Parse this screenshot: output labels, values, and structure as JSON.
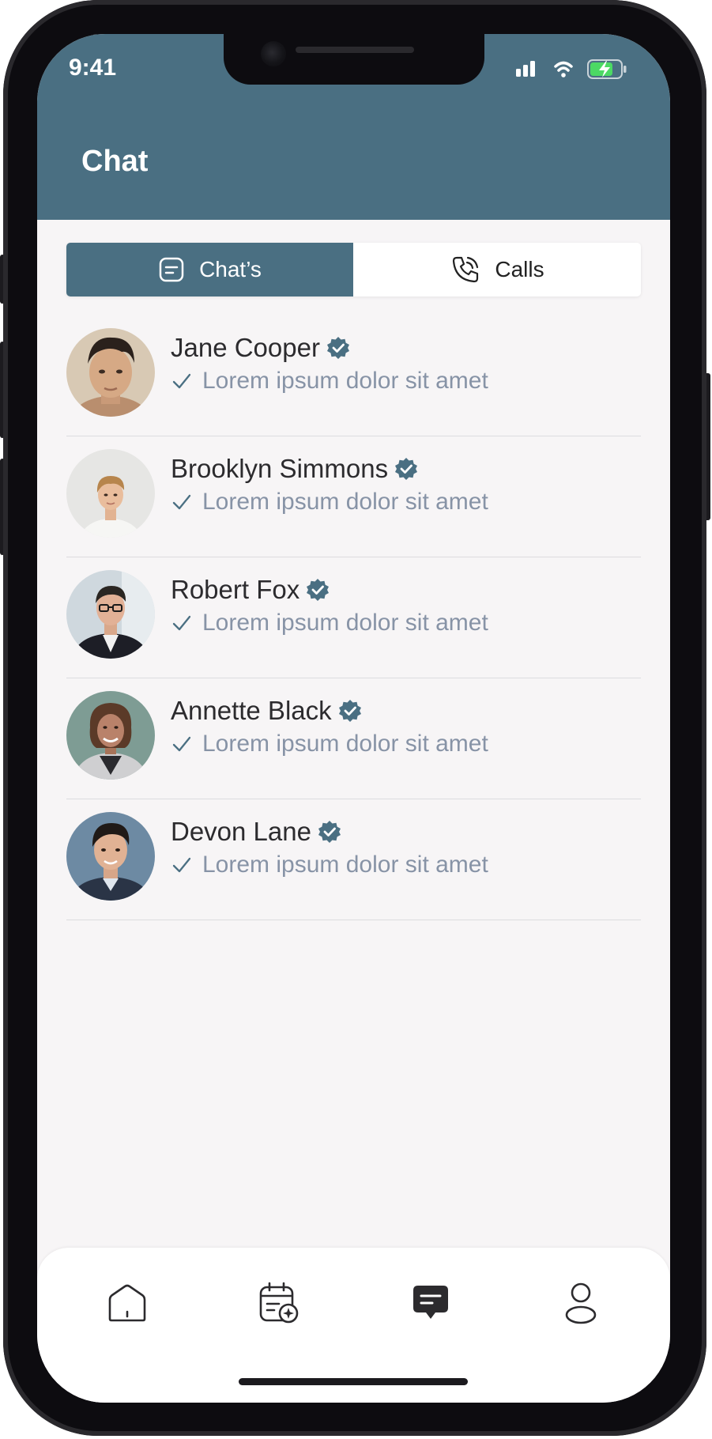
{
  "status_bar": {
    "time": "9:41"
  },
  "header": {
    "title": "Chat"
  },
  "tabs": [
    {
      "label": "Chat’s",
      "icon": "chat-note-icon",
      "active": true
    },
    {
      "label": "Calls",
      "icon": "phone-icon",
      "active": false
    }
  ],
  "contacts": [
    {
      "name": "Jane Cooper",
      "message": "Lorem ipsum dolor sit amet",
      "verified": true,
      "avatar": "avatar-jane-cooper"
    },
    {
      "name": "Brooklyn Simmons",
      "message": "Lorem ipsum dolor sit amet",
      "verified": true,
      "avatar": "avatar-brooklyn-simmons"
    },
    {
      "name": "Robert Fox",
      "message": "Lorem ipsum dolor sit amet",
      "verified": true,
      "avatar": "avatar-robert-fox"
    },
    {
      "name": "Annette Black",
      "message": "Lorem ipsum dolor sit amet",
      "verified": true,
      "avatar": "avatar-annette-black"
    },
    {
      "name": "Devon Lane",
      "message": "Lorem ipsum dolor sit amet",
      "verified": true,
      "avatar": "avatar-devon-lane"
    }
  ],
  "bottom_nav": [
    {
      "icon": "home-icon",
      "active": false
    },
    {
      "icon": "calendar-add-icon",
      "active": false
    },
    {
      "icon": "message-icon",
      "active": true
    },
    {
      "icon": "profile-icon",
      "active": false
    }
  ],
  "colors": {
    "accent": "#4a6f82",
    "background": "#f7f5f6",
    "muted_text": "#8793a6"
  }
}
